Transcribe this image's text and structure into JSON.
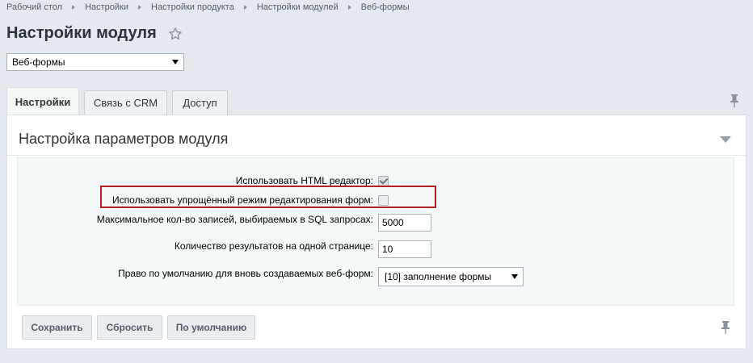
{
  "breadcrumb": [
    "Рабочий стол",
    "Настройки",
    "Настройки продукта",
    "Настройки модулей",
    "Веб-формы"
  ],
  "page_title": "Настройки модуля",
  "module_select": {
    "value": "Веб-формы"
  },
  "tabs": [
    {
      "label": "Настройки",
      "active": true
    },
    {
      "label": "Связь с CRM",
      "active": false
    },
    {
      "label": "Доступ",
      "active": false
    }
  ],
  "section": {
    "title": "Настройка параметров модуля"
  },
  "settings": {
    "html_editor": {
      "label": "Использовать HTML редактор:",
      "checked": true
    },
    "simple_mode": {
      "label": "Использовать упрощённый режим редактирования форм:",
      "checked": false
    },
    "max_records": {
      "label": "Максимальное кол-во записей, выбираемых в SQL запросах:",
      "value": "5000"
    },
    "results_per_page": {
      "label": "Количество результатов на одной странице:",
      "value": "10"
    },
    "default_right": {
      "label": "Право по умолчанию для вновь создаваемых веб-форм:",
      "value": "[10] заполнение формы"
    }
  },
  "buttons": {
    "save": "Сохранить",
    "reset": "Сбросить",
    "default": "По умолчанию"
  },
  "colors": {
    "highlight": "#b22222",
    "background": "#e3e9ee"
  }
}
